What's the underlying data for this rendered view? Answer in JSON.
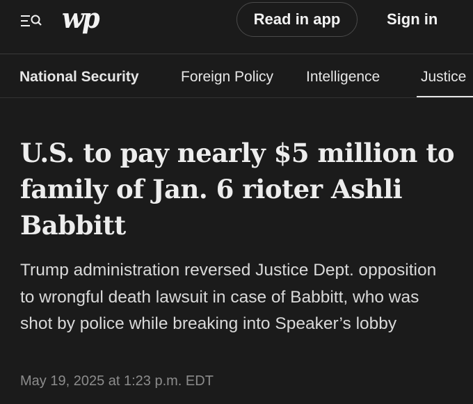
{
  "header": {
    "menu_icon": "menu-search-icon",
    "logo_text": "wp",
    "read_in_app_label": "Read in app",
    "sign_in_label": "Sign in"
  },
  "nav": {
    "items": [
      {
        "label": "National Security",
        "active": true
      },
      {
        "label": "Foreign Policy"
      },
      {
        "label": "Intelligence"
      },
      {
        "label": "Justice"
      }
    ]
  },
  "article": {
    "headline": "U.S. to pay nearly $5 million to family of Jan. 6 rioter Ashli Babbitt",
    "subheadline": "Trump administration reversed Justice Dept. opposition to wrongful death lawsuit in case of Babbitt, who was shot by police while breaking into Speaker’s lobby",
    "timestamp": "May 19, 2025 at 1:23 p.m. EDT"
  },
  "colors": {
    "background": "#1b1b1b",
    "text": "#e9e9e9",
    "muted": "#8c8c8c",
    "border": "#3a3a3a"
  }
}
